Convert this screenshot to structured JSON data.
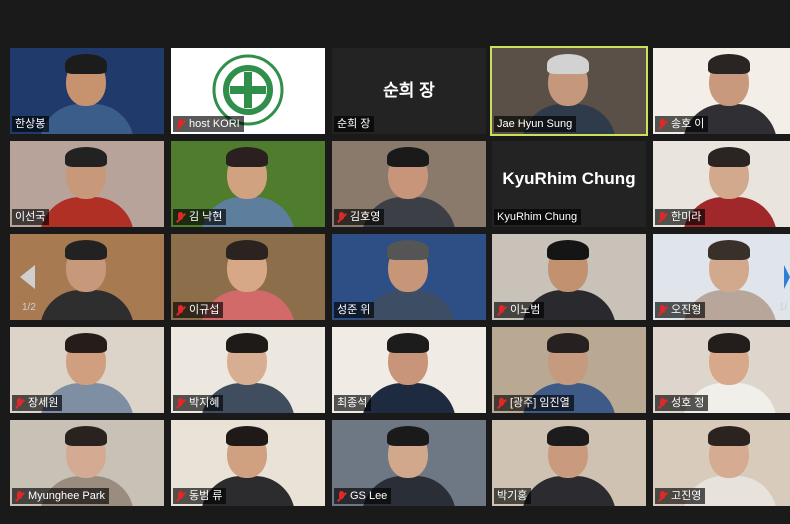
{
  "pagination": {
    "left_label": "1/2",
    "right_label": "1/"
  },
  "colors": {
    "active_speaker": "#c8e35a",
    "muted": "#e02828",
    "background": "#1a1a1a"
  },
  "participants": [
    {
      "name": "한상봉",
      "muted": false,
      "bg": "#1f3a6b",
      "skin": "#c7936f",
      "hair": "#1c1c1c",
      "shirt": "#3b5d8a"
    },
    {
      "name": "host KORI",
      "muted": true,
      "bg": "#ffffff",
      "logo": true
    },
    {
      "name": "순희 장",
      "muted": false,
      "video_off": true,
      "big_label": "순희 장"
    },
    {
      "name": "Jae Hyun Sung",
      "muted": false,
      "active": true,
      "bg": "#5b5047",
      "skin": "#c5977c",
      "hair": "#d2d2d2",
      "shirt": "#2f3b4a"
    },
    {
      "name": "송호 이",
      "muted": true,
      "bg": "#f3efe8",
      "skin": "#c9997e",
      "hair": "#2a2522",
      "shirt": "#2f2f34"
    },
    {
      "name": "이선국",
      "muted": false,
      "bg": "#b7a39a",
      "skin": "#c8987a",
      "hair": "#222",
      "shirt": "#b03025"
    },
    {
      "name": "김 낙현",
      "muted": true,
      "bg": "#4f7d2d",
      "skin": "#d1a27f",
      "hair": "#2a2020",
      "shirt": "#5d7e9d"
    },
    {
      "name": "김호영",
      "muted": true,
      "bg": "#8a7a6c",
      "skin": "#c8957a",
      "hair": "#1a1a1a",
      "shirt": "#3c4046"
    },
    {
      "name": "KyuRhim Chung",
      "muted": false,
      "video_off": true,
      "big_label": "KyuRhim Chung"
    },
    {
      "name": "한미라",
      "muted": true,
      "bg": "#e9e4dd",
      "skin": "#d3a98d",
      "hair": "#2b2422",
      "shirt": "#a0282b"
    },
    {
      "name": "",
      "muted": false,
      "bg": "#a87a52",
      "skin": "#c8987a",
      "hair": "#222",
      "shirt": "#2e2e2e"
    },
    {
      "name": "이규섭",
      "muted": true,
      "bg": "#8c6e4a",
      "skin": "#d7a887",
      "hair": "#2b2320",
      "shirt": "#d26a6a"
    },
    {
      "name": "성준 위",
      "muted": false,
      "bg": "#2d4f86",
      "skin": "#c79578",
      "hair": "#555",
      "shirt": "#3d4d64"
    },
    {
      "name": "이노범",
      "muted": true,
      "bg": "#c9c2b9",
      "skin": "#c2916f",
      "hair": "#151515",
      "shirt": "#2a2a2e"
    },
    {
      "name": "오진형",
      "muted": true,
      "bg": "#dfe5ea",
      "skin": "#d3a98e",
      "hair": "#3a302a",
      "shirt": "#b8a69a"
    },
    {
      "name": "장세원",
      "muted": true,
      "bg": "#dcd4c8",
      "skin": "#cf9f80",
      "hair": "#241d1a",
      "shirt": "#7e8ea3"
    },
    {
      "name": "박지혜",
      "muted": true,
      "bg": "#ece7df",
      "skin": "#d8ae92",
      "hair": "#1e1a18",
      "shirt": "#3f4d5e"
    },
    {
      "name": "최종석",
      "muted": false,
      "bg": "#f0ece5",
      "skin": "#c8947a",
      "hair": "#1c1c1c",
      "shirt": "#1e2a40"
    },
    {
      "name": "[광주] 임진열",
      "muted": true,
      "bg": "#b9a892",
      "skin": "#c69a7f",
      "hair": "#262020",
      "shirt": "#3e5a86"
    },
    {
      "name": "성호 정",
      "muted": true,
      "bg": "#ded6cc",
      "skin": "#d7a88a",
      "hair": "#231d1b",
      "shirt": "#f1efe9"
    },
    {
      "name": "Myunghee Park",
      "muted": true,
      "bg": "#c7c1b6",
      "skin": "#d4ab92",
      "hair": "#2a221f",
      "shirt": "#9a8d80"
    },
    {
      "name": "동범 류",
      "muted": true,
      "bg": "#e9e2d6",
      "skin": "#cfa181",
      "hair": "#1f1a18",
      "shirt": "#2c2c2e"
    },
    {
      "name": "GS Lee",
      "muted": true,
      "bg": "#6e7784",
      "skin": "#d2a88c",
      "hair": "#1a1a1a",
      "shirt": "#2a2e36"
    },
    {
      "name": "박기홍",
      "muted": false,
      "bg": "#cfc2b2",
      "skin": "#c99a7e",
      "hair": "#1c1c1c",
      "shirt": "#2c2c30"
    },
    {
      "name": "고진영",
      "muted": true,
      "bg": "#d8cbbb",
      "skin": "#d5ab92",
      "hair": "#2b231f",
      "shirt": "#e7e3dc"
    }
  ]
}
